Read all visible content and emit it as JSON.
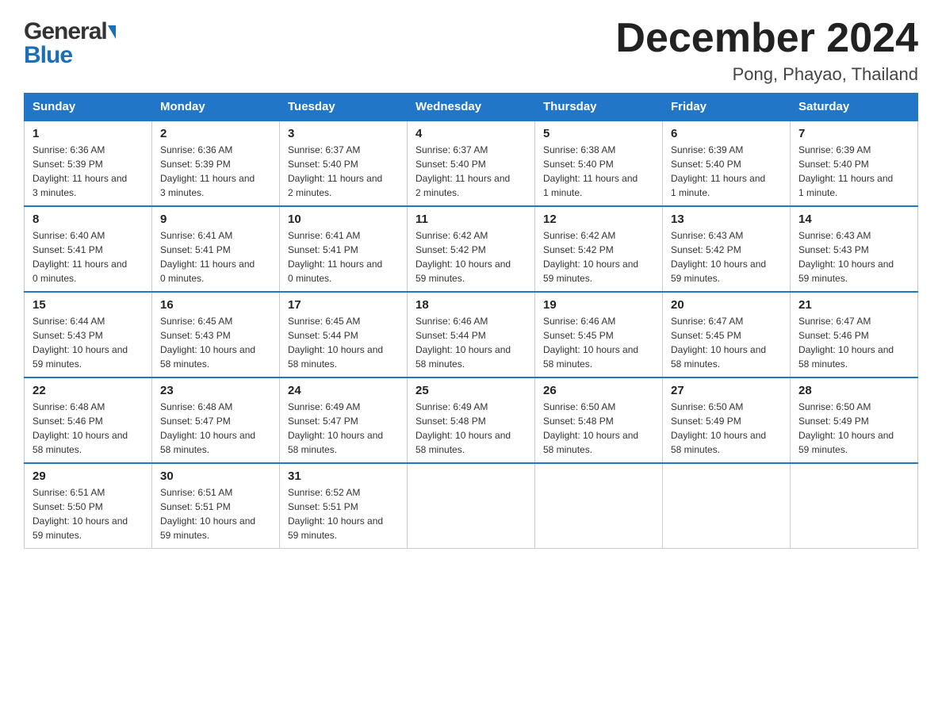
{
  "header": {
    "logo_line1": "General",
    "logo_line2": "Blue",
    "month_title": "December 2024",
    "location": "Pong, Phayao, Thailand"
  },
  "days_of_week": [
    "Sunday",
    "Monday",
    "Tuesday",
    "Wednesday",
    "Thursday",
    "Friday",
    "Saturday"
  ],
  "weeks": [
    [
      {
        "day": "1",
        "sunrise": "6:36 AM",
        "sunset": "5:39 PM",
        "daylight": "11 hours and 3 minutes."
      },
      {
        "day": "2",
        "sunrise": "6:36 AM",
        "sunset": "5:39 PM",
        "daylight": "11 hours and 3 minutes."
      },
      {
        "day": "3",
        "sunrise": "6:37 AM",
        "sunset": "5:40 PM",
        "daylight": "11 hours and 2 minutes."
      },
      {
        "day": "4",
        "sunrise": "6:37 AM",
        "sunset": "5:40 PM",
        "daylight": "11 hours and 2 minutes."
      },
      {
        "day": "5",
        "sunrise": "6:38 AM",
        "sunset": "5:40 PM",
        "daylight": "11 hours and 1 minute."
      },
      {
        "day": "6",
        "sunrise": "6:39 AM",
        "sunset": "5:40 PM",
        "daylight": "11 hours and 1 minute."
      },
      {
        "day": "7",
        "sunrise": "6:39 AM",
        "sunset": "5:40 PM",
        "daylight": "11 hours and 1 minute."
      }
    ],
    [
      {
        "day": "8",
        "sunrise": "6:40 AM",
        "sunset": "5:41 PM",
        "daylight": "11 hours and 0 minutes."
      },
      {
        "day": "9",
        "sunrise": "6:41 AM",
        "sunset": "5:41 PM",
        "daylight": "11 hours and 0 minutes."
      },
      {
        "day": "10",
        "sunrise": "6:41 AM",
        "sunset": "5:41 PM",
        "daylight": "11 hours and 0 minutes."
      },
      {
        "day": "11",
        "sunrise": "6:42 AM",
        "sunset": "5:42 PM",
        "daylight": "10 hours and 59 minutes."
      },
      {
        "day": "12",
        "sunrise": "6:42 AM",
        "sunset": "5:42 PM",
        "daylight": "10 hours and 59 minutes."
      },
      {
        "day": "13",
        "sunrise": "6:43 AM",
        "sunset": "5:42 PM",
        "daylight": "10 hours and 59 minutes."
      },
      {
        "day": "14",
        "sunrise": "6:43 AM",
        "sunset": "5:43 PM",
        "daylight": "10 hours and 59 minutes."
      }
    ],
    [
      {
        "day": "15",
        "sunrise": "6:44 AM",
        "sunset": "5:43 PM",
        "daylight": "10 hours and 59 minutes."
      },
      {
        "day": "16",
        "sunrise": "6:45 AM",
        "sunset": "5:43 PM",
        "daylight": "10 hours and 58 minutes."
      },
      {
        "day": "17",
        "sunrise": "6:45 AM",
        "sunset": "5:44 PM",
        "daylight": "10 hours and 58 minutes."
      },
      {
        "day": "18",
        "sunrise": "6:46 AM",
        "sunset": "5:44 PM",
        "daylight": "10 hours and 58 minutes."
      },
      {
        "day": "19",
        "sunrise": "6:46 AM",
        "sunset": "5:45 PM",
        "daylight": "10 hours and 58 minutes."
      },
      {
        "day": "20",
        "sunrise": "6:47 AM",
        "sunset": "5:45 PM",
        "daylight": "10 hours and 58 minutes."
      },
      {
        "day": "21",
        "sunrise": "6:47 AM",
        "sunset": "5:46 PM",
        "daylight": "10 hours and 58 minutes."
      }
    ],
    [
      {
        "day": "22",
        "sunrise": "6:48 AM",
        "sunset": "5:46 PM",
        "daylight": "10 hours and 58 minutes."
      },
      {
        "day": "23",
        "sunrise": "6:48 AM",
        "sunset": "5:47 PM",
        "daylight": "10 hours and 58 minutes."
      },
      {
        "day": "24",
        "sunrise": "6:49 AM",
        "sunset": "5:47 PM",
        "daylight": "10 hours and 58 minutes."
      },
      {
        "day": "25",
        "sunrise": "6:49 AM",
        "sunset": "5:48 PM",
        "daylight": "10 hours and 58 minutes."
      },
      {
        "day": "26",
        "sunrise": "6:50 AM",
        "sunset": "5:48 PM",
        "daylight": "10 hours and 58 minutes."
      },
      {
        "day": "27",
        "sunrise": "6:50 AM",
        "sunset": "5:49 PM",
        "daylight": "10 hours and 58 minutes."
      },
      {
        "day": "28",
        "sunrise": "6:50 AM",
        "sunset": "5:49 PM",
        "daylight": "10 hours and 59 minutes."
      }
    ],
    [
      {
        "day": "29",
        "sunrise": "6:51 AM",
        "sunset": "5:50 PM",
        "daylight": "10 hours and 59 minutes."
      },
      {
        "day": "30",
        "sunrise": "6:51 AM",
        "sunset": "5:51 PM",
        "daylight": "10 hours and 59 minutes."
      },
      {
        "day": "31",
        "sunrise": "6:52 AM",
        "sunset": "5:51 PM",
        "daylight": "10 hours and 59 minutes."
      },
      null,
      null,
      null,
      null
    ]
  ],
  "labels": {
    "sunrise": "Sunrise:",
    "sunset": "Sunset:",
    "daylight": "Daylight:"
  }
}
